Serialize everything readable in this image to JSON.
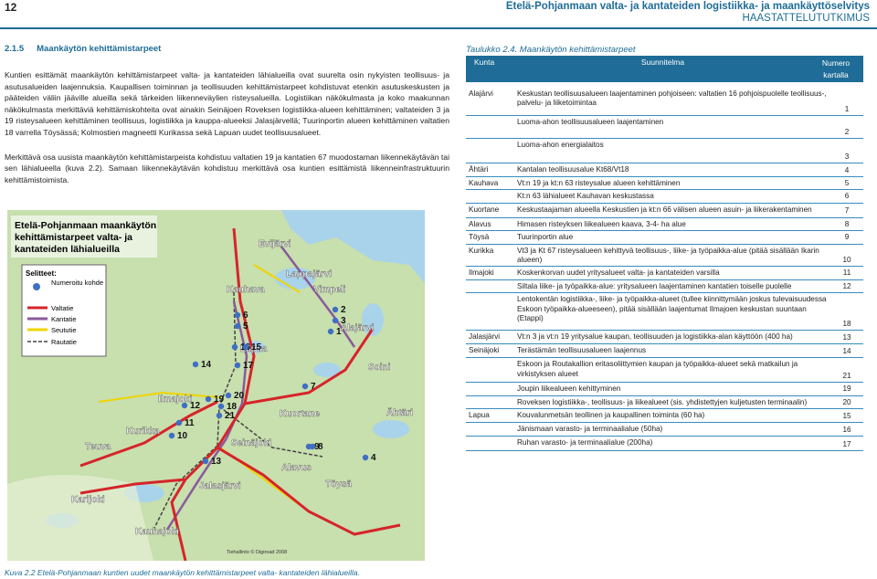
{
  "page": {
    "number": "12",
    "header_line1": "Etelä-Pohjanmaan valta- ja kantateiden logistiikka- ja maankäyttöselvitys",
    "header_line2": "HAASTATTELUTUTKIMUS"
  },
  "section": {
    "number": "2.1.5",
    "title": "Maankäytön kehittämistarpeet",
    "para1": "Kuntien esittämät maankäytön kehittämistarpeet valta- ja kantateiden lähialueilla ovat suurelta osin nykyisten teollisuus- ja asutusalueiden laajennuksia. Kaupallisen toiminnan ja teollisuuden kehittämistarpeet kohdistuvat etenkin asutuskeskusten ja pääteiden väliin jääville alueilla sekä tärkeiden liikenneväylien risteysalueilla. Logistiikan näkökulmasta ja koko maakunnan näkökulmasta merkittäviä kehittämiskohteita ovat ainakin Seinäjoen Roveksen logistiikka-alueen kehittäminen; valtateiden 3 ja 19 risteysalueen kehittäminen teollisuus, logistiikka ja kauppa-alueeksi Jalasjärvellä; Tuurinportin alueen kehittäminen valtatien 18 varrella Töysässä; Kolmostien magneetti Kurikassa sekä Lapuan uudet teollisuusalueet.",
    "para2": "Merkittävä osa uusista maankäytön kehittämistarpeista kohdistuu valtatien 19 ja kantatien 67 muodostaman liikennekäytävän tai sen lähialueella (kuva 2.2). Samaan liikennekäytävän kohdistuu merkittävä osa kuntien esittämistä liikenneinfrastruktuurin kehittämistoimista."
  },
  "map": {
    "title_line1": "Etelä-Pohjanmaan maankäytön",
    "title_line2": "kehittämistarpeet valta- ja",
    "title_line3": "kantateiden lähialueilla",
    "legend_title": "Selitteet:",
    "legend_items": [
      "Numeroitu kohde",
      "Valtatie",
      "Kantatie",
      "Seututie",
      "Rautatie"
    ],
    "places": [
      "Evijärvi",
      "Lappajärvi",
      "Vimpeli",
      "Kauhava",
      "Alajärvi",
      "Lapua",
      "Soini",
      "Ilmajoki",
      "Kuortane",
      "Ähtäri",
      "Kurikka",
      "Seinäjoki",
      "Töysä",
      "Teuva",
      "Alavus",
      "Jalasjärvi",
      "Karijoki",
      "Kauhajoki"
    ],
    "numbers": [
      "6",
      "5",
      "2",
      "3",
      "1",
      "16",
      "15",
      "17",
      "14",
      "19",
      "20",
      "12",
      "18",
      "21",
      "7",
      "11",
      "10",
      "9",
      "8",
      "4",
      "13"
    ],
    "copyright": "Tiehallinto © Digiroad 2008"
  },
  "caption": "Kuva 2.2 Etelä-Pohjanmaan kuntien uudet maankäytön kehittämistarpeet valta- kantateiden lähialueilla.",
  "table": {
    "caption": "Taulukko 2.4. Maankäytön kehittämistarpeet",
    "headers": {
      "c1": "Kunta",
      "c2": "Suunnitelma",
      "c3a": "Numero",
      "c3b": "kartalla"
    },
    "rows": [
      {
        "kunta": "Alajärvi",
        "text": "Keskustan teollisuusalueen laajentaminen pohjoiseen: valtatien 16 pohjoispuolelle teollisuus-, palvelu- ja liiketoimintaa",
        "num": "1"
      },
      {
        "kunta": "",
        "text": "Luoma-ahon teollisuusalueen laajentaminen",
        "num": "2"
      },
      {
        "kunta": "",
        "text": "Luoma-ahon energialaitos",
        "num": "3"
      },
      {
        "kunta": "Ähtäri",
        "text": "Kantalan teollisuusalue Kt68/Vt18",
        "num": "4"
      },
      {
        "kunta": "Kauhava",
        "text": "Vt:n 19 ja kt:n 63 risteysalue alueen kehittäminen",
        "num": "5"
      },
      {
        "kunta": "",
        "text": "Kt:n 63 lähialueet Kauhavan keskustassa",
        "num": "6"
      },
      {
        "kunta": "Kuortane",
        "text": "Keskustaajaman alueella Keskustien ja kt:n 66 välisen alueen asuin- ja liikerakentaminen",
        "num": "7"
      },
      {
        "kunta": "Alavus",
        "text": "Himasen risteyksen liikealueen kaava, 3-4- ha alue",
        "num": "8"
      },
      {
        "kunta": "Töysä",
        "text": "Tuurinportin alue",
        "num": "9"
      },
      {
        "kunta": "Kurikka",
        "text": "Vt3 ja Kt 67 risteysalueen kehittyvä teollisuus-, liike- ja työpaikka-alue (pitää sisällään Ikarin alueen)",
        "num": "10"
      },
      {
        "kunta": "Ilmajoki",
        "text": "Koskenkorvan uudet yritysalueet valta- ja kantateiden varsilla",
        "num": "11"
      },
      {
        "kunta": "",
        "text": "Siltala liike- ja työpaikka-alue: yritysalueen laajentaminen kantatien toiselle puolelle",
        "num": "12"
      },
      {
        "kunta": "",
        "text": "Lentokentän logistiikka-, liike- ja työpaikka-alueet (tullee kiinnittymään joskus tulevaisuudessa Eskoon työpaikka-alueeseen), pitää sisällään laajentumat Ilmajoen keskustan suuntaan (Etappi)",
        "num": "18"
      },
      {
        "kunta": "Jalasjärvi",
        "text": "Vt:n 3 ja vt:n 19 yritysalue kaupan, teollisuuden ja logistiikka-alan käyttöön (400 ha)",
        "num": "13"
      },
      {
        "kunta": "Seinäjoki",
        "text": "Terästämän teollisuusalueen laajennus",
        "num": "14"
      },
      {
        "kunta": "",
        "text": "Eskoon ja Routakallion eritasoliittymien kaupan ja työpaikka-alueet sekä matkailun ja virkistyksen alueet",
        "num": "21"
      },
      {
        "kunta": "",
        "text": "Joupin liikealueen kehittyminen",
        "num": "19"
      },
      {
        "kunta": "",
        "text": "Roveksen logistiikka-, teollisuus- ja liikealueet (sis. yhdistettyjen kuljetusten terminaalin)",
        "num": "20"
      },
      {
        "kunta": "Lapua",
        "text": "Kouvalunmetsän teollinen ja kaupallinen toiminta (60 ha)",
        "num": "15"
      },
      {
        "kunta": "",
        "text": "Jänismaan varasto- ja terminaalialue (50ha)",
        "num": "16"
      },
      {
        "kunta": "",
        "text": "Ruhan varasto- ja terminaalialue (200ha)",
        "num": "17"
      }
    ]
  },
  "colors": {
    "accent": "#1e6c97",
    "map_land": "#c8dfae",
    "map_water": "#a9d3ea",
    "valtatie": "#d6242a",
    "kantatie": "#8a5a9c",
    "seututie": "#f0d400"
  }
}
